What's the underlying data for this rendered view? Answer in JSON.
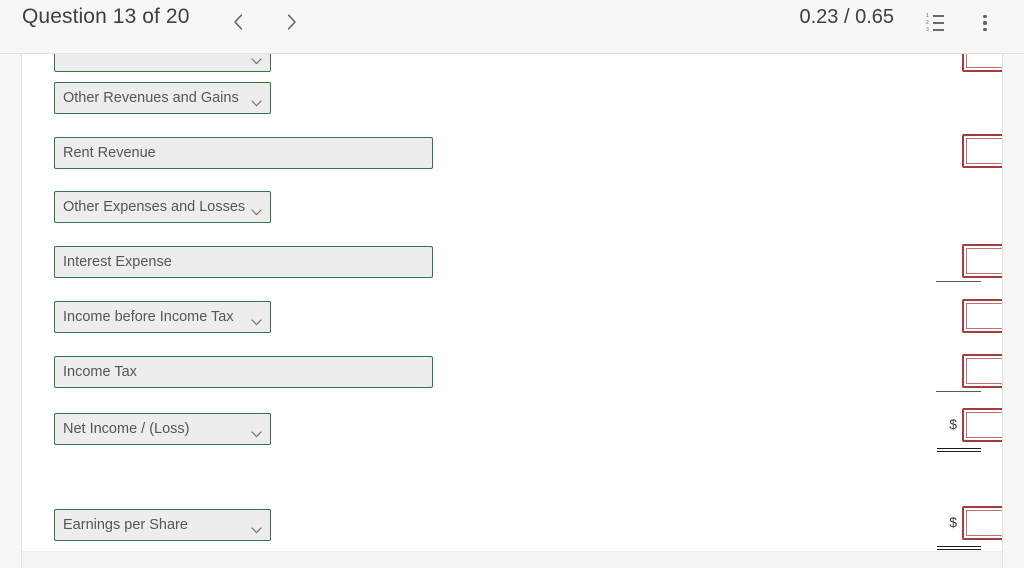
{
  "header": {
    "question_label": "Question 13 of 20",
    "prev_icon": "chevron-left-icon",
    "next_icon": "chevron-right-icon",
    "score": "0.23 / 0.65",
    "list_icon": "numbered-list-icon",
    "list_markers": [
      "1",
      "2",
      "3"
    ],
    "more_icon": "more-vertical-icon"
  },
  "form": {
    "partial_top_select": {
      "type": "select",
      "value": ""
    },
    "rows": [
      {
        "kind": "select",
        "value": "Other Revenues and Gains"
      },
      {
        "kind": "text",
        "value": "Rent Revenue"
      },
      {
        "kind": "select",
        "value": "Other Expenses and Losses"
      },
      {
        "kind": "text",
        "value": "Interest Expense"
      },
      {
        "kind": "select",
        "value": "Income before Income Tax"
      },
      {
        "kind": "text",
        "value": "Income Tax"
      },
      {
        "kind": "select",
        "value": "Net Income / (Loss)"
      },
      {
        "kind": "select",
        "value": "Earnings per Share"
      }
    ],
    "chevron_icon": "chevron-down-icon"
  },
  "amounts": {
    "currency_symbol": "$",
    "entries": [
      {
        "value": "",
        "prefix": "",
        "rule": "none"
      },
      {
        "value": "",
        "prefix": "",
        "rule": "none"
      },
      {
        "value": "",
        "prefix": "",
        "rule": "single"
      },
      {
        "value": "",
        "prefix": "",
        "rule": "none"
      },
      {
        "value": "",
        "prefix": "",
        "rule": "single"
      },
      {
        "value": "",
        "prefix": "$",
        "rule": "double"
      },
      {
        "value": "",
        "prefix": "$",
        "rule": "double"
      }
    ]
  },
  "colors": {
    "field_border": "#2e7a42",
    "field_fill": "#ededed",
    "amount_border": "#a33c3c",
    "amount_inner_border": "#cb7070",
    "header_bg": "#f7f7f7",
    "text": "#3c4043"
  }
}
